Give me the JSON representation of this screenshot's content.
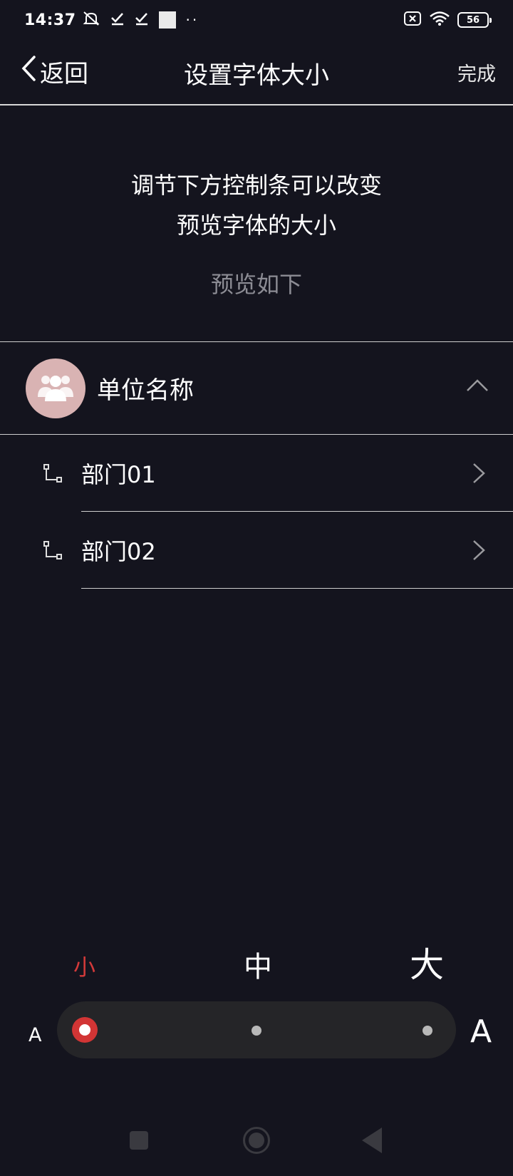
{
  "status_bar": {
    "time": "14:37",
    "battery": "56",
    "icons": [
      "mute-bell-icon",
      "check-icon",
      "check-icon",
      "square-icon",
      "more-dots-icon",
      "close-box-icon",
      "wifi-icon",
      "battery-icon"
    ]
  },
  "nav": {
    "back_label": "返回",
    "title": "设置字体大小",
    "done_label": "完成"
  },
  "intro": {
    "line1": "调节下方控制条可以改变",
    "line2": "预览字体的大小",
    "preview_label": "预览如下"
  },
  "org": {
    "name": "单位名称",
    "avatar_color": "#d9b3b3"
  },
  "departments": [
    {
      "name": "部门01"
    },
    {
      "name": "部门02"
    }
  ],
  "font_size": {
    "labels": {
      "small": "小",
      "medium": "中",
      "large": "大"
    },
    "small_marker": "A",
    "large_marker": "A",
    "selected": "小",
    "accent_color": "#d23535"
  },
  "system_nav": [
    "recent-apps-icon",
    "home-icon",
    "back-icon"
  ]
}
